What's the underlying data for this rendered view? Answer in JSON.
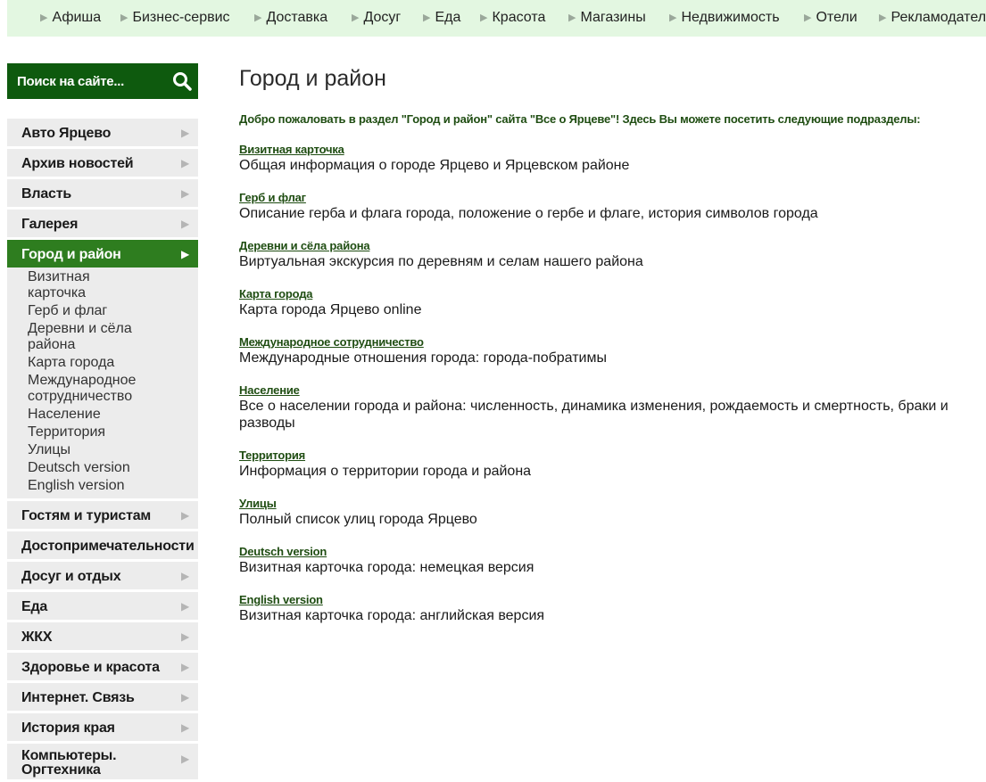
{
  "top_nav": [
    "Афиша",
    "Бизнес-сервис",
    "Доставка",
    "Досуг",
    "Еда",
    "Красота",
    "Магазины",
    "Недвижимость",
    "Отели",
    "Рекламодатели"
  ],
  "search": {
    "placeholder": "Поиск на сайте..."
  },
  "sidebar": {
    "items_before": [
      "Авто Ярцево",
      "Архив новостей",
      "Власть",
      "Галерея"
    ],
    "active": "Город и район",
    "subitems": [
      "Визитная карточка",
      "Герб и флаг",
      "Деревни и сёла района",
      "Карта города",
      "Международное сотрудничество",
      "Население",
      "Территория",
      "Улицы",
      "Deutsch version",
      "English version"
    ],
    "items_after": [
      "Гостям и туристам",
      "Достопримечательности",
      "Досуг и отдых",
      "Еда",
      "ЖКХ",
      "Здоровье и красота",
      "Интернет. Связь",
      "История края",
      "Компьютеры. Оргтехника"
    ]
  },
  "main": {
    "title": "Город и район",
    "intro": "Добро пожаловать в раздел \"Город и район\" сайта \"Все о Ярцеве\"! Здесь Вы можете посетить следующие подразделы:",
    "sections": [
      {
        "title": "Визитная карточка",
        "desc": "Общая информация о городе Ярцево и Ярцевском районе"
      },
      {
        "title": "Герб и флаг",
        "desc": "Описание герба и флага города, положение о гербе и флаге, история символов города"
      },
      {
        "title": "Деревни и сёла района",
        "desc": "Виртуальная экскурсия по деревням и селам нашего района"
      },
      {
        "title": "Карта города",
        "desc": "Карта города Ярцево online"
      },
      {
        "title": "Международное сотрудничество",
        "desc": "Международные отношения города: города-побратимы"
      },
      {
        "title": "Население",
        "desc": "Все о населении города и района: численность, динамика изменения, рождаемость и смертность, браки и разводы"
      },
      {
        "title": "Территория",
        "desc": "Информация о территории города и района"
      },
      {
        "title": "Улицы",
        "desc": "Полный список улиц города Ярцево"
      },
      {
        "title": "Deutsch version",
        "desc": "Визитная карточка города: немецкая версия"
      },
      {
        "title": "English version",
        "desc": "Визитная карточка города: английская версия"
      }
    ]
  },
  "colors": {
    "topbar_bg": "#e3f7e1",
    "search_bg": "#0e5a0e",
    "active_bg": "#2e7d1f",
    "link": "#1f4d12"
  },
  "icons": {
    "search": "search-icon",
    "chevron": "chevron-right-icon",
    "arrow": "triangle-right-icon"
  }
}
